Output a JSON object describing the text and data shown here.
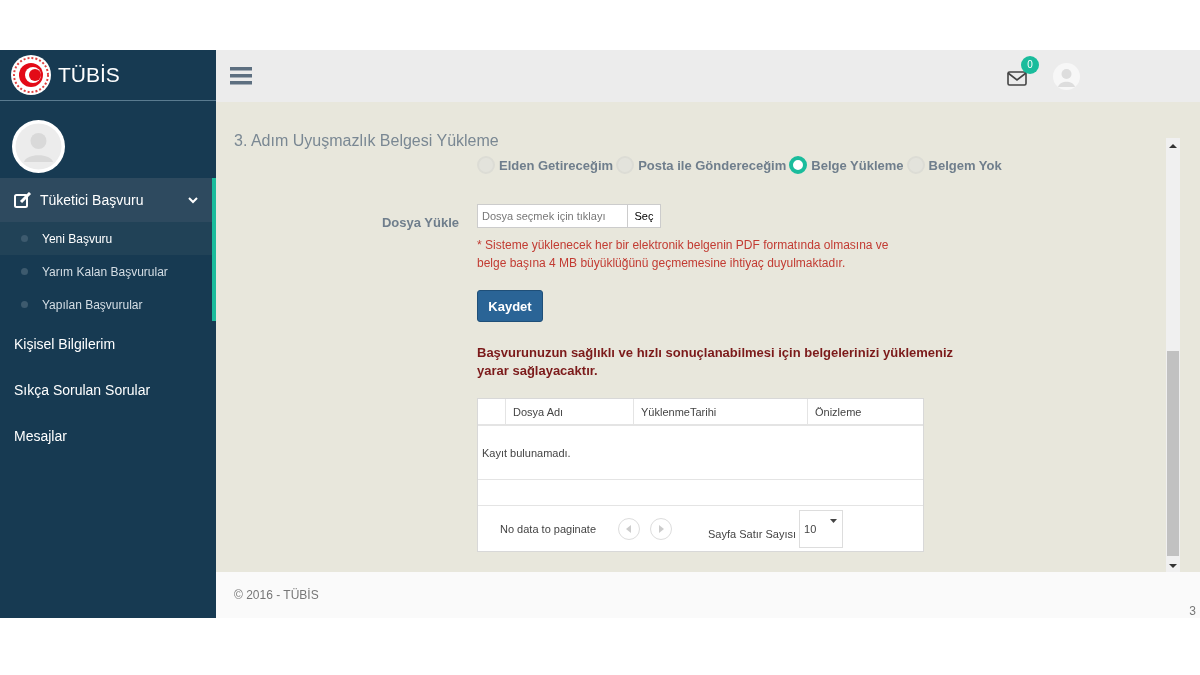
{
  "logo": {
    "title": "TÜBİS"
  },
  "topbar": {
    "mail_count": "0"
  },
  "sidebar": {
    "items": [
      {
        "label": "Tüketici Başvuru",
        "selected": true,
        "expanded": true,
        "children": [
          {
            "label": "Yeni Başvuru",
            "selected": true
          },
          {
            "label": "Yarım Kalan Başvurular",
            "selected": false
          },
          {
            "label": "Yapılan Başvurular",
            "selected": false
          }
        ]
      },
      {
        "label": "Kişisel Bilgilerim",
        "selected": false
      },
      {
        "label": "Sıkça Sorulan Sorular",
        "selected": false
      },
      {
        "label": "Mesajlar",
        "selected": false
      }
    ]
  },
  "form": {
    "title": "3. Adım Uyuşmazlık Belgesi Yükleme",
    "options": [
      {
        "label": "Elden Getireceğim",
        "selected": false
      },
      {
        "label": "Posta ile Göndereceğim",
        "selected": false
      },
      {
        "label": "Belge Yükleme",
        "selected": true
      },
      {
        "label": "Belgem Yok",
        "selected": false
      }
    ],
    "upload": {
      "label": "Dosya Yükle",
      "placeholder": "Dosya seçmek için tıklayı",
      "button": "Seç"
    },
    "note": "* Sisteme yüklenecek her bir elektronik belgenin PDF formatında olmasına ve belge başına 4 MB büyüklüğünü geçmemesine ihtiyaç duyulmaktadır.",
    "save": "Kaydet",
    "hint": "Başvurunuzun sağlıklı ve hızlı sonuçlanabilmesi için belgelerinizi yüklemeniz yarar sağlayacaktır."
  },
  "table": {
    "columns": [
      "Dosya Adı",
      "YüklenmeTarihi",
      "Önizleme"
    ],
    "empty": "Kayıt bulunamadı.",
    "pager": {
      "text": "No data to paginate",
      "rows_label": "Sayfa Satır Sayısı",
      "rows_value": "10"
    }
  },
  "footer": {
    "copyright": "© 2016 - TÜBİS",
    "page": "3"
  }
}
